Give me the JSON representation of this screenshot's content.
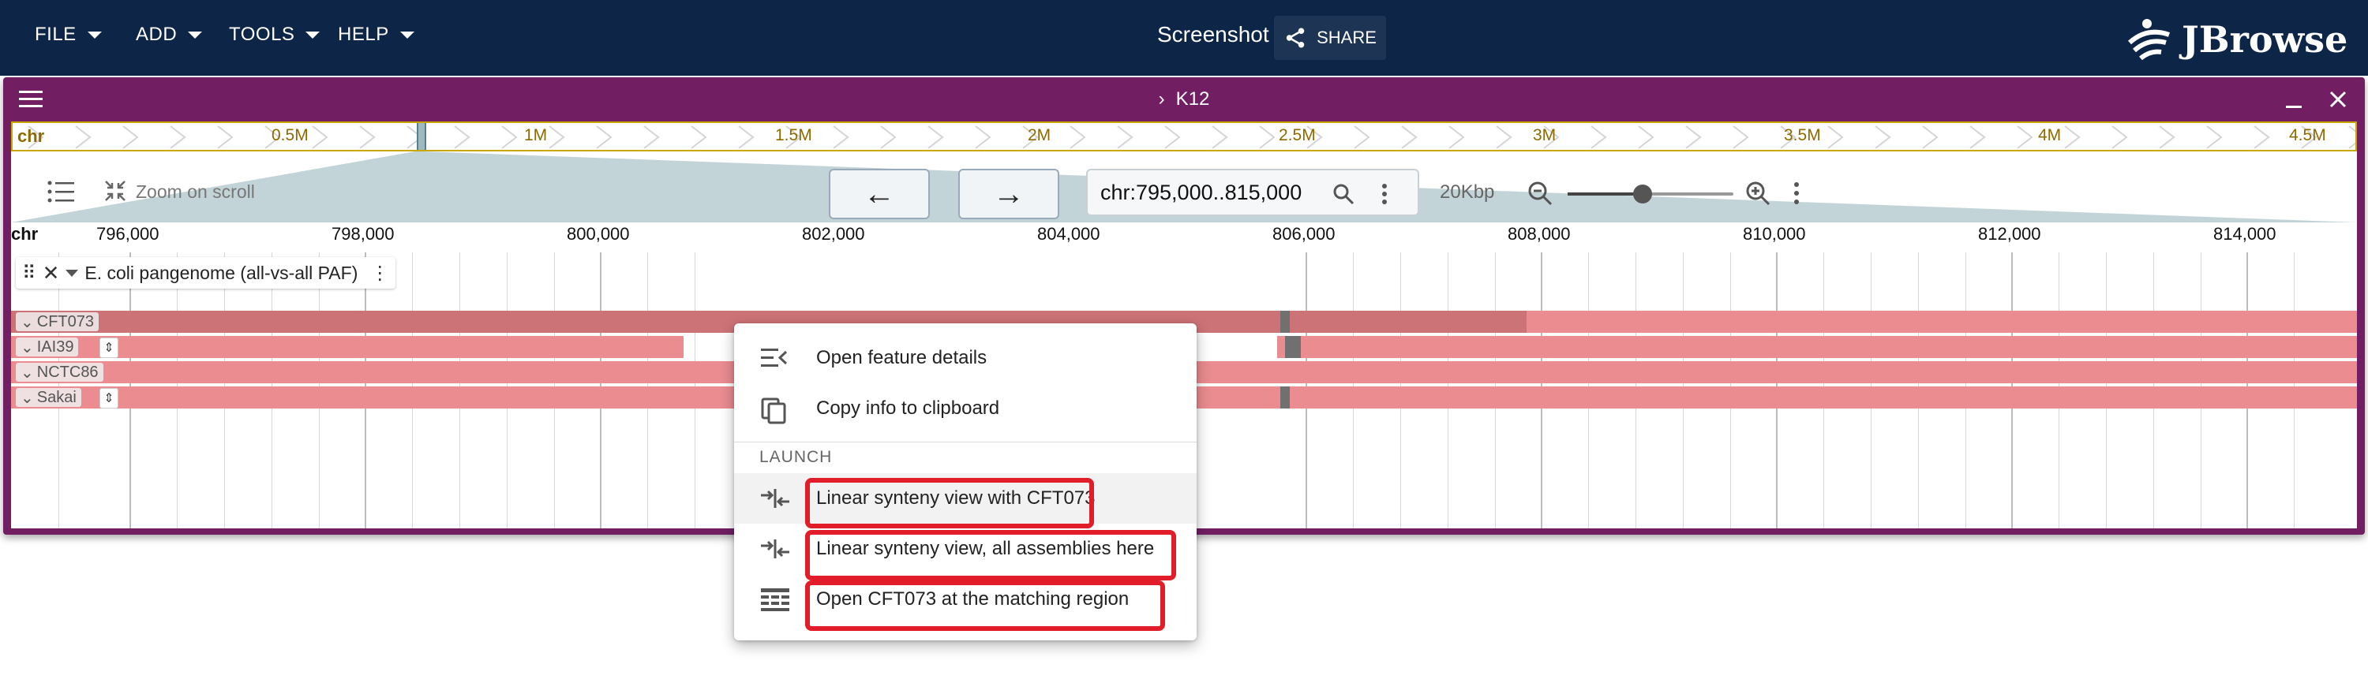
{
  "app": {
    "menus": [
      "FILE",
      "ADD",
      "TOOLS",
      "HELP"
    ],
    "session_name": "Screenshot",
    "share_label": "SHARE",
    "logo_text": "JBrowse",
    "colors": {
      "topbar": "#0d2547",
      "view_frame": "#721e63",
      "highlight": "#e11d2a"
    }
  },
  "view": {
    "title": "K12",
    "overview": {
      "chr_label": "chr",
      "ticks": [
        "0.5M",
        "1M",
        "1.5M",
        "2M",
        "2.5M",
        "3M",
        "3.5M",
        "4M",
        "4.5M"
      ]
    },
    "toolbar": {
      "zoom_on_scroll_label": "Zoom on scroll",
      "location": "chr:795,000..815,000",
      "bp_per_px_label": "20Kbp",
      "zoom_level": 0.45
    },
    "ruler": {
      "chr_label": "chr",
      "ticks": [
        "796,000",
        "798,000",
        "800,000",
        "802,000",
        "804,000",
        "806,000",
        "808,000",
        "810,000",
        "812,000",
        "814,000"
      ]
    },
    "track": {
      "name": "E. coli pangenome (all-vs-all PAF)",
      "rows": [
        "CFT073",
        "IAI39",
        "NCTC86",
        "Sakai"
      ]
    }
  },
  "context_menu": {
    "items": [
      {
        "icon": "feature-details-icon",
        "label": "Open feature details"
      },
      {
        "icon": "copy-icon",
        "label": "Copy info to clipboard"
      }
    ],
    "section": "LAUNCH",
    "launch_items": [
      {
        "icon": "synteny-icon",
        "label": "Linear synteny view with CFT073"
      },
      {
        "icon": "synteny-icon",
        "label": "Linear synteny view, all assemblies here"
      },
      {
        "icon": "table-icon",
        "label": "Open CFT073 at the matching region"
      }
    ]
  }
}
